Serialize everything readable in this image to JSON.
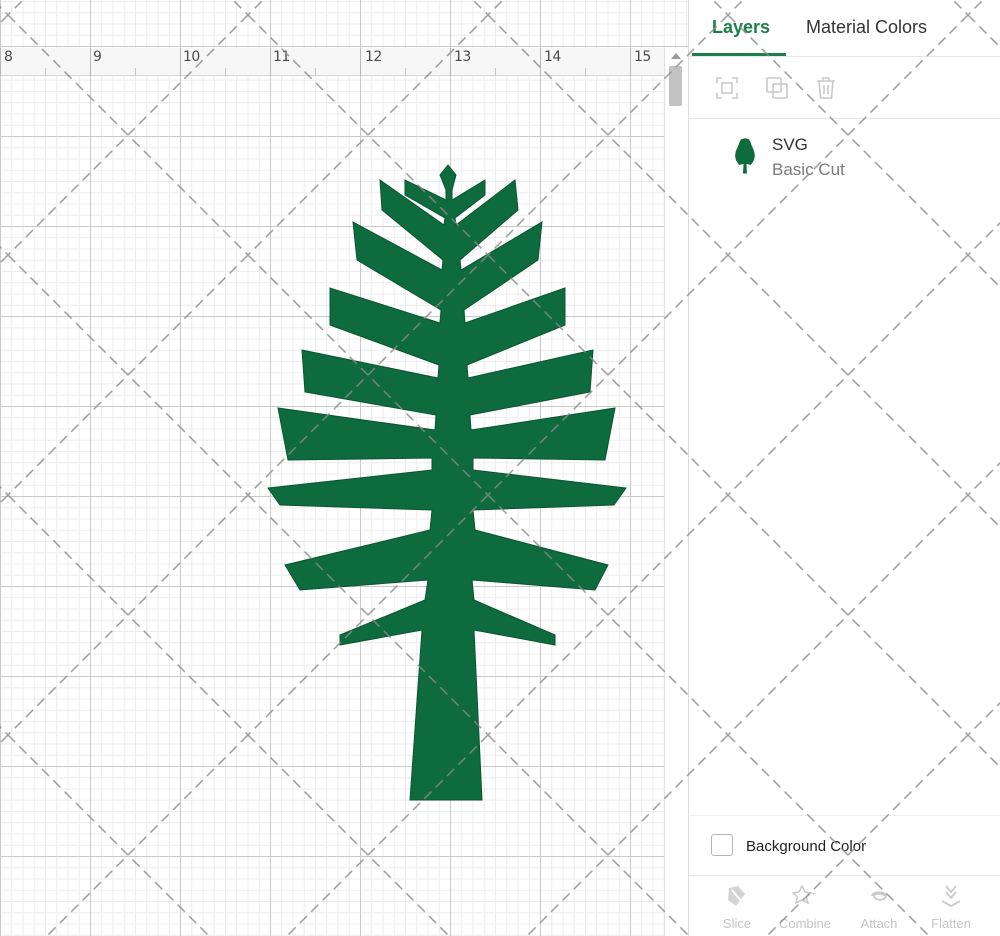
{
  "ruler": {
    "labels": [
      "8",
      "9",
      "10",
      "11",
      "12",
      "13",
      "14",
      "15"
    ]
  },
  "panel": {
    "tabs": [
      {
        "label": "Layers"
      },
      {
        "label": "Material Colors"
      }
    ],
    "toolbar_icons": [
      "group-icon",
      "duplicate-icon",
      "delete-icon"
    ],
    "layer": {
      "name": "SVG",
      "operation": "Basic Cut",
      "color": "#0e6b3d"
    },
    "background_color_label": "Background Color",
    "bottom_tools": [
      {
        "label": "Slice",
        "icon": "slice-icon"
      },
      {
        "label": "Combine",
        "icon": "combine-icon"
      },
      {
        "label": "Attach",
        "icon": "attach-icon"
      },
      {
        "label": "Flatten",
        "icon": "flatten-icon"
      }
    ]
  },
  "colors": {
    "accent": "#1a7f4b",
    "shape_fill": "#0e6b3d",
    "disabled": "#c4c4c4"
  }
}
